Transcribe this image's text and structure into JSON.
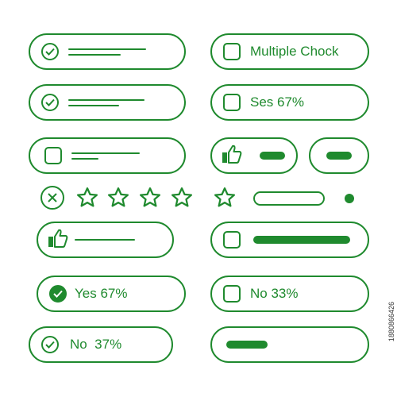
{
  "options": {
    "multiple_choice": "Multiple Chock",
    "ses": "Ses 67%",
    "yes": "Yes 67%",
    "no_33": "No 33%",
    "no_37": "No  37%"
  },
  "rating": {
    "stars_total": 5
  },
  "watermark_id": "1880866426",
  "colors": {
    "accent": "#1f8a2e",
    "background": "#ffffff"
  }
}
